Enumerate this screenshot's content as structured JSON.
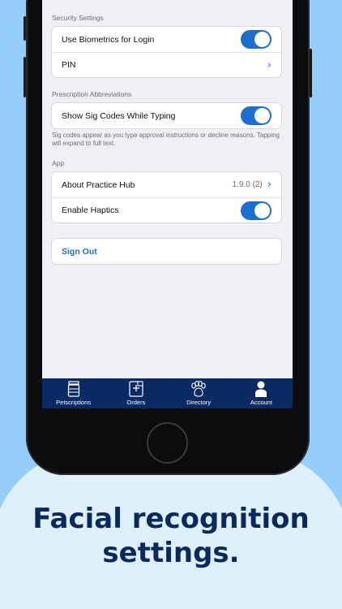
{
  "settings": {
    "security": {
      "header": "Security Settings",
      "biometrics_label": "Use Biometrics for Login",
      "biometrics_on": true,
      "pin_label": "PIN"
    },
    "prescription": {
      "header": "Prescription Abbreviations",
      "sig_codes_label": "Show Sig Codes While Typing",
      "sig_codes_on": true,
      "note": "Sig codes appear as you type approval instructions or decline reasons. Tapping will expand to full text."
    },
    "app": {
      "header": "App",
      "about_label": "About Practice Hub",
      "about_value": "1.9.0 (2)",
      "haptics_label": "Enable Haptics",
      "haptics_on": true
    },
    "sign_out_label": "Sign Out"
  },
  "tabbar": {
    "tabs": [
      {
        "label": "Petscriptions",
        "icon": "pill-bottle-icon"
      },
      {
        "label": "Orders",
        "icon": "order-form-icon"
      },
      {
        "label": "Directory",
        "icon": "paw-icon"
      },
      {
        "label": "Account",
        "icon": "person-icon"
      }
    ]
  },
  "caption": {
    "line1": "Facial recognition",
    "line2": "settings."
  },
  "colors": {
    "accent": "#1a6fd0",
    "tabbar": "#0a2a63",
    "background_blue": "#95cdfb",
    "caption": "#0a2a5c"
  }
}
